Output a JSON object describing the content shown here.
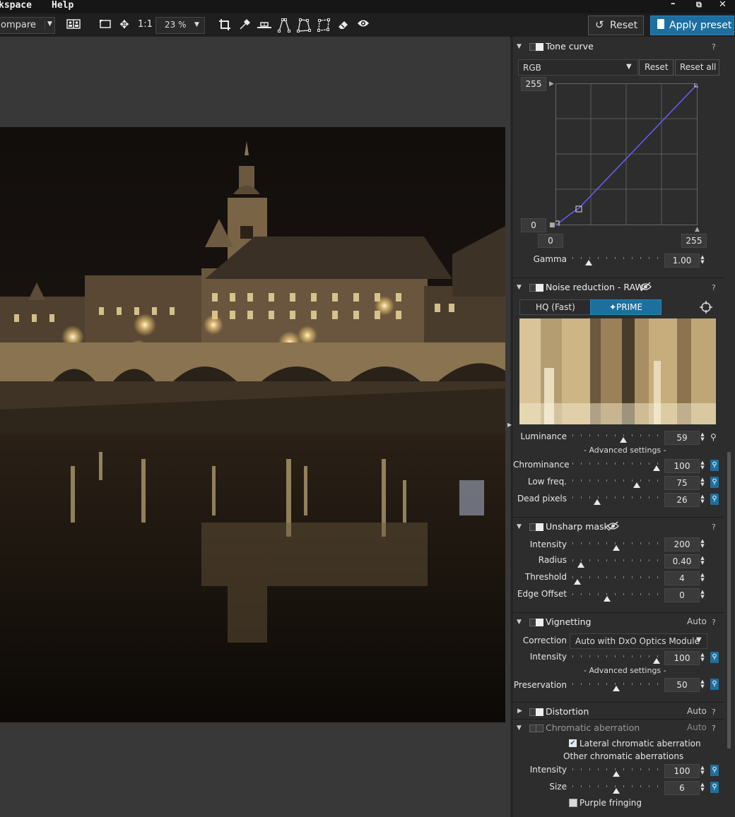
{
  "menubar": {
    "items": [
      "kspace",
      "Help"
    ]
  },
  "toolbar": {
    "compare_label": "ompare",
    "fit_label": "1:1",
    "zoom_value": "23 %",
    "reset_label": "Reset",
    "apply_preset_label": "Apply preset"
  },
  "icons": [
    "side-by-side-icon",
    "fit-screen-icon",
    "move-icon",
    "crop-icon",
    "eyedropper-icon",
    "horizon-icon",
    "perspective-icon",
    "perspective-8pt-icon",
    "perspective-rect-icon",
    "eraser-icon",
    "preview-eye-icon",
    "reset-history-icon",
    "preset-icon",
    "close-icon",
    "restore-icon",
    "minimize-icon"
  ],
  "colors": {
    "accent": "#1d6f9f",
    "panel_bg": "#2d2d2d",
    "curve": "#6a5cff"
  },
  "tone_curve": {
    "title": "Tone curve",
    "help": "?",
    "channel": "RGB",
    "reset_label": "Reset",
    "reset_all_label": "Reset all",
    "out_max": "255",
    "out_min": "0",
    "in_min": "0",
    "in_max": "255",
    "gamma_label": "Gamma",
    "gamma_value": "1.00",
    "gamma_pos": 0.16
  },
  "noise": {
    "title": "Noise reduction - RAW",
    "help": "?",
    "hq_label": "HQ (Fast)",
    "prime_label": "✦PRIME",
    "luminance_label": "Luminance",
    "luminance_value": "59",
    "luminance_pos": 0.59,
    "advanced_label": "- Advanced settings -",
    "chrominance_label": "Chrominance",
    "chrominance_value": "100",
    "chrominance_pos": 1.0,
    "lowfreq_label": "Low freq.",
    "lowfreq_value": "75",
    "lowfreq_pos": 0.75,
    "dead_label": "Dead pixels",
    "dead_value": "26",
    "dead_pos": 0.26
  },
  "unsharp": {
    "title": "Unsharp mask",
    "help": "?",
    "intensity_label": "Intensity",
    "intensity_value": "200",
    "intensity_pos": 0.5,
    "radius_label": "Radius",
    "radius_value": "0.40",
    "radius_pos": 0.06,
    "threshold_label": "Threshold",
    "threshold_value": "4",
    "threshold_pos": 0.02,
    "edge_label": "Edge Offset",
    "edge_value": "0",
    "edge_pos": 0.39
  },
  "vignetting": {
    "title": "Vignetting",
    "auto": "Auto",
    "help": "?",
    "correction_label": "Correction",
    "correction_value": "Auto with DxO Optics Module",
    "intensity_label": "Intensity",
    "intensity_value": "100",
    "intensity_pos": 1.0,
    "advanced_label": "- Advanced settings -",
    "preservation_label": "Preservation",
    "preservation_value": "50",
    "preservation_pos": 0.5
  },
  "distortion": {
    "title": "Distortion",
    "auto": "Auto",
    "help": "?"
  },
  "chromatic": {
    "title": "Chromatic aberration",
    "auto": "Auto",
    "help": "?",
    "lateral_label": "Lateral chromatic aberration",
    "lateral_checked": true,
    "other_label": "Other chromatic aberrations",
    "intensity_label": "Intensity",
    "intensity_value": "100",
    "intensity_pos": 0.5,
    "size_label": "Size",
    "size_value": "6",
    "size_pos": 0.5,
    "purple_label": "Purple fringing",
    "purple_checked": false
  }
}
